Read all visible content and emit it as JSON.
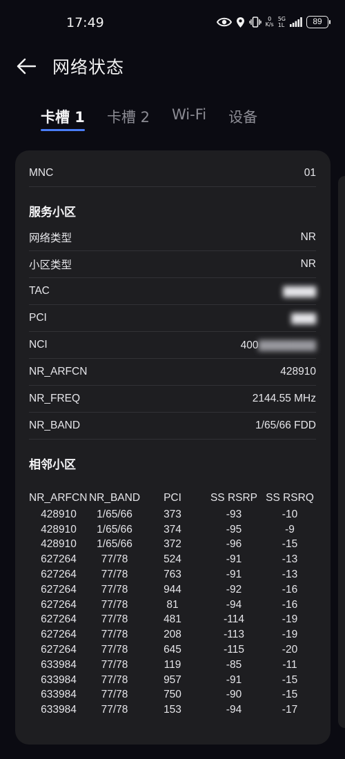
{
  "status_bar": {
    "time": "17:49",
    "speed_value": "0",
    "speed_unit": "K/s",
    "network": "5G",
    "network_sub": "1L",
    "battery": "89"
  },
  "header": {
    "title": "网络状态"
  },
  "tabs": [
    {
      "label": "卡槽 1",
      "active": true
    },
    {
      "label": "卡槽 2",
      "active": false
    },
    {
      "label": "Wi-Fi",
      "active": false
    },
    {
      "label": "设备",
      "active": false
    }
  ],
  "mnc": {
    "key": "MNC",
    "value": "01"
  },
  "serving": {
    "title": "服务小区",
    "rows": [
      {
        "key": "网络类型",
        "value": "NR"
      },
      {
        "key": "小区类型",
        "value": "NR"
      },
      {
        "key": "TAC",
        "value": ""
      },
      {
        "key": "PCI",
        "value": ""
      },
      {
        "key": "NCI",
        "value": "400"
      },
      {
        "key": "NR_ARFCN",
        "value": "428910"
      },
      {
        "key": "NR_FREQ",
        "value": "2144.55 MHz"
      },
      {
        "key": "NR_BAND",
        "value": "1/65/66 FDD"
      }
    ]
  },
  "neighbour": {
    "title": "相邻小区",
    "headers": [
      "NR_ARFCN",
      "NR_BAND",
      "PCI",
      "SS RSRP",
      "SS RSRQ"
    ],
    "rows": [
      [
        "428910",
        "1/65/66",
        "373",
        "-93",
        "-10"
      ],
      [
        "428910",
        "1/65/66",
        "374",
        "-95",
        "-9"
      ],
      [
        "428910",
        "1/65/66",
        "372",
        "-96",
        "-15"
      ],
      [
        "627264",
        "77/78",
        "524",
        "-91",
        "-13"
      ],
      [
        "627264",
        "77/78",
        "763",
        "-91",
        "-13"
      ],
      [
        "627264",
        "77/78",
        "944",
        "-92",
        "-16"
      ],
      [
        "627264",
        "77/78",
        "81",
        "-94",
        "-16"
      ],
      [
        "627264",
        "77/78",
        "481",
        "-114",
        "-19"
      ],
      [
        "627264",
        "77/78",
        "208",
        "-113",
        "-19"
      ],
      [
        "627264",
        "77/78",
        "645",
        "-115",
        "-20"
      ],
      [
        "633984",
        "77/78",
        "119",
        "-85",
        "-11"
      ],
      [
        "633984",
        "77/78",
        "957",
        "-91",
        "-15"
      ],
      [
        "633984",
        "77/78",
        "750",
        "-90",
        "-15"
      ],
      [
        "633984",
        "77/78",
        "153",
        "-94",
        "-17"
      ]
    ]
  },
  "colors": {
    "accent": "#4a7df7",
    "card": "#1e1e21",
    "background": "#0b0b12"
  },
  "icons": [
    "back-arrow-icon",
    "eye-icon",
    "location-icon",
    "vibrate-icon",
    "signal-icon"
  ]
}
